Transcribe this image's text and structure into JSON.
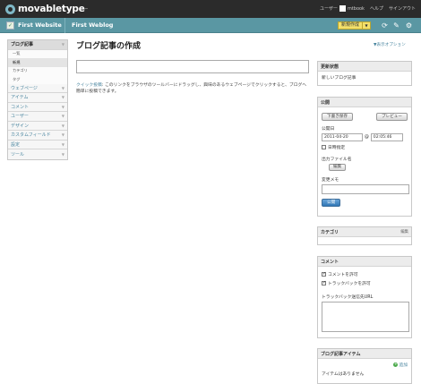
{
  "header": {
    "logo_text": "movabletype",
    "logo_tm": "™",
    "user_label": "ユーザー",
    "username": "mtbook",
    "help": "ヘルプ",
    "signout": "サインアウト"
  },
  "sitebar": {
    "site_name": "First Website",
    "blog_name": "First Weblog",
    "new_button": "新規作成"
  },
  "nav": {
    "entries": "ブログ記事",
    "entries_sub": [
      "一覧",
      "新規",
      "カテゴリ",
      "タグ"
    ],
    "items": [
      "ウェブページ",
      "アイテム",
      "コメント",
      "ユーザー",
      "デザイン",
      "カスタムフィールド",
      "設定",
      "ツール"
    ]
  },
  "main": {
    "title": "ブログ記事の作成",
    "display_options": "▼表示オプション",
    "quickpost_link": "クイック投稿",
    "quickpost_text": ": このリンクをブラウザのツールバーにドラッグし、興味のあるウェブページでクリックすると、ブログへ簡単に投稿できます。"
  },
  "widgets": {
    "status": {
      "title": "更新状態",
      "text": "新しいブログ記事"
    },
    "publish": {
      "title": "公開",
      "draft_button": "下書き保存",
      "preview_button": "プレビュー",
      "date_label": "公開日",
      "date_value": "2011-04-20",
      "at": "@",
      "time_value": "02:05:46",
      "schedule_label": "日時指定",
      "basename_label": "出力ファイル名",
      "basename_button": "編集",
      "memo_label": "変更メモ",
      "publish_button": "公開"
    },
    "category": {
      "title": "カテゴリ",
      "edit": "編集"
    },
    "comments": {
      "title": "コメント",
      "allow_comments": "コメントを許可",
      "allow_trackbacks": "トラックバックを許可",
      "ping_label": "トラックバック送信先URL"
    },
    "assets": {
      "title": "ブログ記事アイテム",
      "add": "追加",
      "none": "アイテムはありません"
    }
  },
  "colors": {
    "sitebar": "#5a97a3",
    "topbar": "#2b2b2b",
    "link": "#4a86a0",
    "new_button": "#f3e06a",
    "publish_button": "#2f76b6"
  }
}
